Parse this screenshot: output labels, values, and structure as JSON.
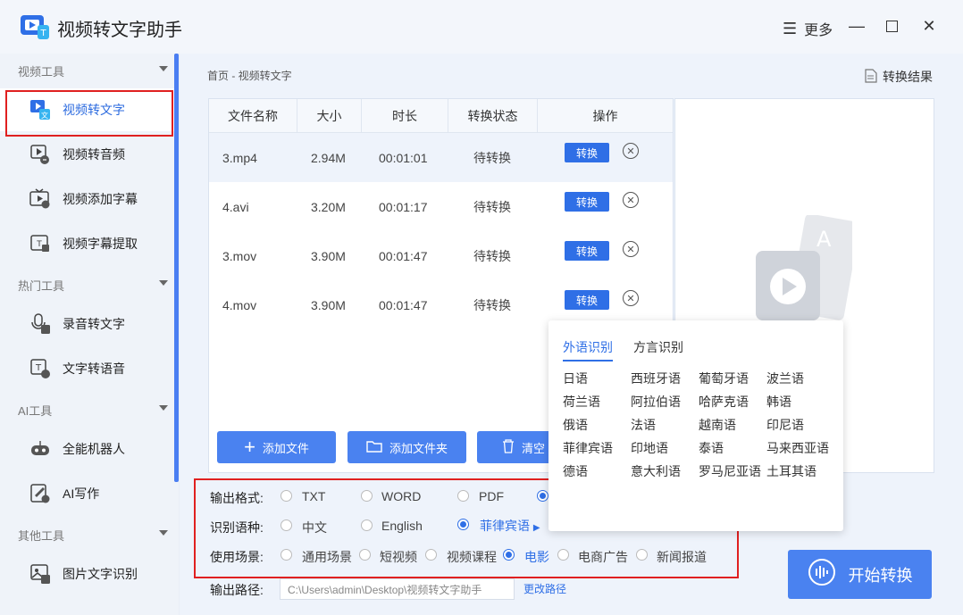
{
  "app": {
    "title": "视频转文字助手",
    "more_label": "更多"
  },
  "sidebar": {
    "sections": [
      {
        "label": "视频工具",
        "items": [
          {
            "label": "视频转文字",
            "icon": "video-to-text-icon"
          },
          {
            "label": "视频转音频",
            "icon": "video-to-audio-icon"
          },
          {
            "label": "视频添加字幕",
            "icon": "add-subtitle-icon"
          },
          {
            "label": "视频字幕提取",
            "icon": "extract-subtitle-icon"
          }
        ]
      },
      {
        "label": "热门工具",
        "items": [
          {
            "label": "录音转文字",
            "icon": "mic-to-text-icon"
          },
          {
            "label": "文字转语音",
            "icon": "text-to-speech-icon"
          }
        ]
      },
      {
        "label": "AI工具",
        "items": [
          {
            "label": "全能机器人",
            "icon": "robot-icon"
          },
          {
            "label": "AI写作",
            "icon": "ai-write-icon"
          }
        ]
      },
      {
        "label": "其他工具",
        "items": [
          {
            "label": "图片文字识别",
            "icon": "image-ocr-icon"
          }
        ]
      }
    ]
  },
  "breadcrumb": "首页 - 视频转文字",
  "result_label": "转换结果",
  "table": {
    "headers": [
      "文件名称",
      "大小",
      "时长",
      "转换状态",
      "操作"
    ],
    "rows": [
      {
        "name": "3.mp4",
        "size": "2.94M",
        "duration": "00:01:01",
        "status": "待转换",
        "action": "转换"
      },
      {
        "name": "4.avi",
        "size": "3.20M",
        "duration": "00:01:17",
        "status": "待转换",
        "action": "转换"
      },
      {
        "name": "3.mov",
        "size": "3.90M",
        "duration": "00:01:47",
        "status": "待转换",
        "action": "转换"
      },
      {
        "name": "4.mov",
        "size": "3.90M",
        "duration": "00:01:47",
        "status": "待转换",
        "action": "转换"
      }
    ]
  },
  "buttons": {
    "add_file": "添加文件",
    "add_folder": "添加文件夹",
    "clear": "清空"
  },
  "popup": {
    "tabs": [
      "外语识别",
      "方言识别"
    ],
    "languages": [
      [
        "日语",
        "西班牙语",
        "葡萄牙语",
        "波兰语"
      ],
      [
        "荷兰语",
        "阿拉伯语",
        "哈萨克语",
        "韩语"
      ],
      [
        "俄语",
        "法语",
        "越南语",
        "印尼语"
      ],
      [
        "菲律宾语",
        "印地语",
        "泰语",
        "马来西亚语"
      ],
      [
        "德语",
        "意大利语",
        "罗马尼亚语",
        "土耳其语"
      ]
    ]
  },
  "options": {
    "format": {
      "label": "输出格式:",
      "choices": [
        "TXT",
        "WORD",
        "PDF"
      ]
    },
    "language": {
      "label": "识别语种:",
      "choices": [
        "中文",
        "English",
        "菲律宾语"
      ],
      "selected": "菲律宾语"
    },
    "scene": {
      "label": "使用场景:",
      "choices": [
        "通用场景",
        "短视频",
        "视频课程",
        "电影",
        "电商广告",
        "新闻报道"
      ],
      "selected": "电影"
    }
  },
  "output": {
    "label": "输出路径:",
    "path": "C:\\Users\\admin\\Desktop\\视频转文字助手",
    "change": "更改路径"
  },
  "start_button": "开始转换",
  "colors": {
    "accent": "#2f6fe6",
    "highlight_box": "#e02020"
  }
}
